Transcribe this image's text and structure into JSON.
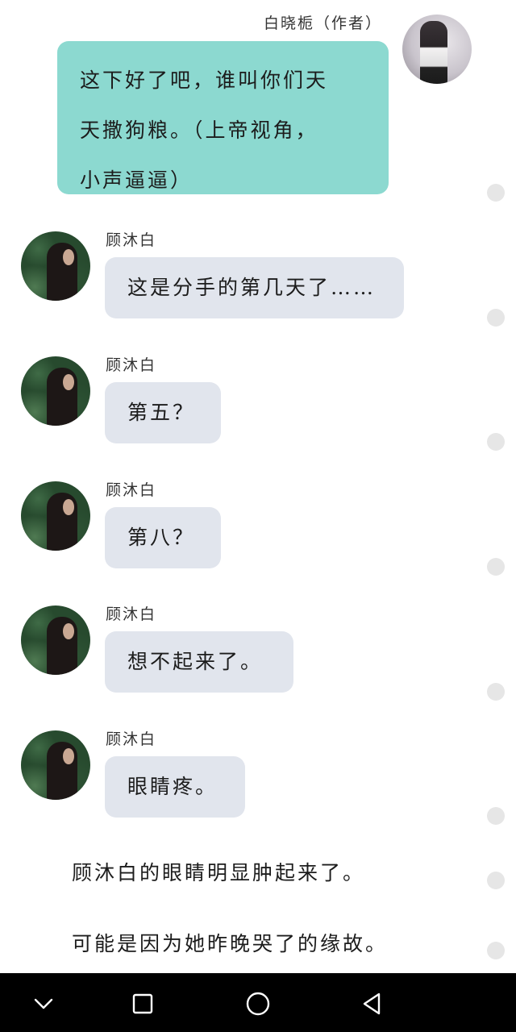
{
  "author": {
    "name": "白晓栀（作者）",
    "message": "这下好了吧，谁叫你们天天撒狗粮。（上帝视角，小声逼逼）",
    "message_lines": [
      "这下好了吧，谁叫你们天",
      "天撒狗粮。（上帝视角，",
      "小声逼逼）"
    ]
  },
  "messages": [
    {
      "sender": "顾沐白",
      "text": "这是分手的第几天了……"
    },
    {
      "sender": "顾沐白",
      "text": "第五？"
    },
    {
      "sender": "顾沐白",
      "text": "第八？"
    },
    {
      "sender": "顾沐白",
      "text": "想不起来了。"
    },
    {
      "sender": "顾沐白",
      "text": "眼睛疼。"
    }
  ],
  "narration": [
    "顾沐白的眼睛明显肿起来了。",
    "可能是因为她昨晚哭了的缘故。"
  ],
  "navbar": {
    "icons": [
      "chevron-down-icon",
      "square-recents-icon",
      "circle-home-icon",
      "triangle-back-icon"
    ]
  }
}
